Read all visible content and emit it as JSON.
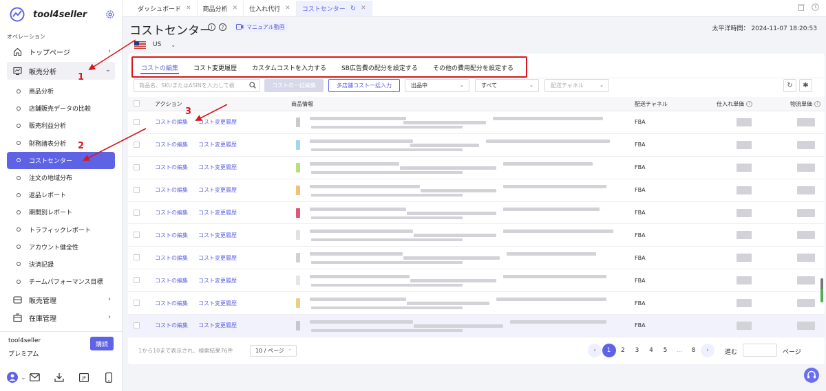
{
  "app": {
    "brand": "tool4seller",
    "section_label": "オペレーション"
  },
  "sidebar": {
    "items": [
      {
        "label": "トップページ",
        "icon": "home-icon"
      },
      {
        "label": "販売分析",
        "icon": "chart-monitor-icon"
      }
    ],
    "sub_items": [
      "商品分析",
      "店舗販売データの比較",
      "販売利益分析",
      "財務諸表分析",
      "コストセンター",
      "注文の地域分布",
      "返品レポート",
      "期間別レポート",
      "トラフィックレポート",
      "アカウント健全性",
      "決済記録",
      "チームパフォーマンス目標"
    ],
    "lower_items": [
      {
        "label": "販売管理",
        "icon": "sales-box-icon"
      },
      {
        "label": "在庫管理",
        "icon": "inventory-icon"
      }
    ],
    "plan_name": "tool4seller",
    "plan_tier": "プレミアム",
    "buy_label": "購読"
  },
  "page_tabs": [
    {
      "label": "ダッシュボード"
    },
    {
      "label": "商品分析"
    },
    {
      "label": "仕入れ代行"
    },
    {
      "label": "コストセンター"
    }
  ],
  "header": {
    "title": "コストセンター",
    "manual_label": "マニュアル動画",
    "timezone_label": "太平洋時間：",
    "timestamp": "2024-11-07 18:20:53",
    "country": "US"
  },
  "subtabs": [
    "コストの編集",
    "コスト変更履歴",
    "カスタムコストを入力する",
    "SB広告費の配分を設定する",
    "その他の費用配分を設定する"
  ],
  "filters": {
    "search_placeholder": "商品名、SKUまたはASINを入力して検",
    "batch_edit_label": "コストの一括編集",
    "multi_store_label": "多店舗コスト一括入力",
    "status_value": "出品中",
    "all_value": "すべて",
    "channel_placeholder": "配送チャネル"
  },
  "table": {
    "headers": {
      "action": "アクション",
      "product": "商品情報",
      "channel": "配送チャネル",
      "purchase_price": "仕入れ単価",
      "logistics_price": "物流単価"
    },
    "action_edit": "コストの編集",
    "action_history": "コスト変更履歴",
    "rows": [
      {
        "channel": "FBA",
        "thumb": "#c9c9cf"
      },
      {
        "channel": "FBA",
        "thumb": "#9fd7ef"
      },
      {
        "channel": "FBA",
        "thumb": "#b9de7a"
      },
      {
        "channel": "FBA",
        "thumb": "#f2c07a"
      },
      {
        "channel": "FBA",
        "thumb": "#e0557a"
      },
      {
        "channel": "FBA",
        "thumb": "#e0e0e6"
      },
      {
        "channel": "FBA",
        "thumb": "#d0d0d6"
      },
      {
        "channel": "FBA",
        "thumb": "#e6e6ea"
      },
      {
        "channel": "FBA",
        "thumb": "#e9d08a"
      },
      {
        "channel": "FBA",
        "thumb": "#c7c7cd"
      }
    ]
  },
  "pagination": {
    "summary": "1から10まで表示され、検索結果76件",
    "per_page": "10 / ページ",
    "pages": [
      "1",
      "2",
      "3",
      "4",
      "5",
      "...",
      "8"
    ],
    "goto_label": "進む",
    "page_suffix": "ページ"
  },
  "annotations": [
    "1",
    "2",
    "3"
  ],
  "colors": {
    "accent": "#5e63e6",
    "annotation_red": "#d9161c"
  }
}
